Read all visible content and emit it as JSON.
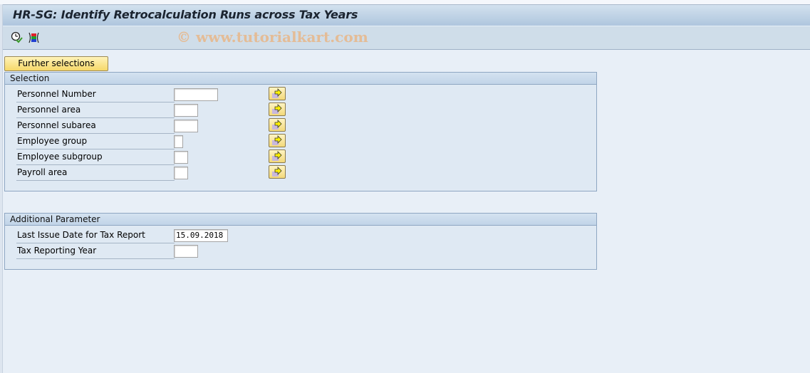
{
  "window": {
    "title": "HR-SG: Identify Retrocalculation Runs across Tax Years"
  },
  "toolbar": {
    "icons": [
      {
        "name": "execute-clock-check-icon",
        "tooltip": ""
      },
      {
        "name": "selection-screen-variant-icon",
        "tooltip": ""
      }
    ],
    "watermark": "© www.tutorialkart.com"
  },
  "further_selections_label": "Further selections",
  "selection": {
    "title": "Selection",
    "fields": [
      {
        "label": "Personnel Number",
        "value": ""
      },
      {
        "label": "Personnel area",
        "value": ""
      },
      {
        "label": "Personnel subarea",
        "value": ""
      },
      {
        "label": "Employee group",
        "value": ""
      },
      {
        "label": "Employee subgroup",
        "value": ""
      },
      {
        "label": "Payroll area",
        "value": ""
      }
    ],
    "multiple_selection_icon": "arrow-right-multiple-selection-icon"
  },
  "additional": {
    "title": "Additional Parameter",
    "fields": [
      {
        "label": "Last Issue Date for Tax Report",
        "value": "15.09.2018"
      },
      {
        "label": "Tax Reporting Year",
        "value": ""
      }
    ]
  }
}
